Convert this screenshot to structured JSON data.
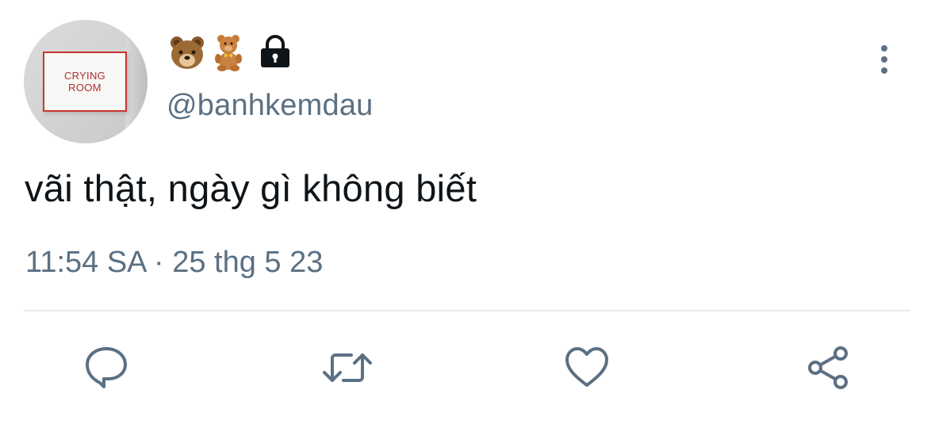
{
  "avatar": {
    "sign_line1": "CRYING",
    "sign_line2": "ROOM"
  },
  "user": {
    "name_emojis": [
      "bear-face-emoji",
      "teddy-bear-emoji"
    ],
    "protected_icon": "lock-icon",
    "handle": "@banhkemdau"
  },
  "tweet": {
    "text": "vãi thật, ngày gì không biết",
    "time": "11:54 SA",
    "separator": "·",
    "date": "25 thg 5 23"
  },
  "actions": [
    {
      "icon": "reply-icon"
    },
    {
      "icon": "retweet-icon"
    },
    {
      "icon": "like-icon"
    },
    {
      "icon": "share-icon"
    }
  ],
  "menu": {
    "icon": "more-vertical-icon"
  },
  "colors": {
    "text": "#0f1419",
    "secondary": "#5b7083",
    "divider": "#e6ecf0",
    "sign_red": "#c9352f"
  }
}
